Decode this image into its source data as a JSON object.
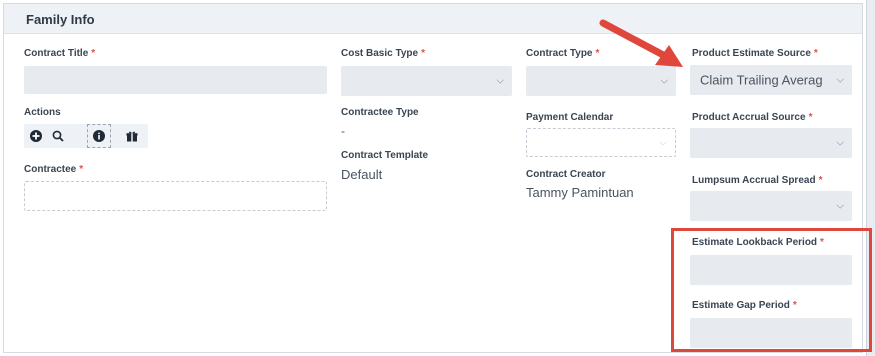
{
  "section": {
    "title": "Family Info"
  },
  "fields": {
    "contract_title": {
      "label": "Contract Title",
      "required": "*",
      "value": ""
    },
    "cost_basic_type": {
      "label": "Cost Basic Type",
      "required": "*"
    },
    "contract_type": {
      "label": "Contract Type",
      "required": "*"
    },
    "product_estimate_source": {
      "label": "Product Estimate Source",
      "required": "*",
      "value": "Claim Trailing Averag"
    },
    "actions": {
      "label": "Actions"
    },
    "contractee_type": {
      "label": "Contractee Type",
      "value": "-"
    },
    "payment_calendar": {
      "label": "Payment Calendar"
    },
    "product_accrual_source": {
      "label": "Product Accrual Source",
      "required": "*"
    },
    "contract_template": {
      "label": "Contract Template",
      "value": "Default"
    },
    "contractee": {
      "label": "Contractee",
      "required": "*"
    },
    "contract_creator": {
      "label": "Contract Creator",
      "value": "Tammy Pamintuan"
    },
    "lumpsum_accrual_spread": {
      "label": "Lumpsum Accrual Spread",
      "required": "*"
    },
    "estimate_lookback_period": {
      "label": "Estimate Lookback Period",
      "required": "*"
    },
    "estimate_gap_period": {
      "label": "Estimate Gap Period",
      "required": "*"
    }
  },
  "toolbar": {
    "icons": [
      "plus-circle-icon",
      "search-icon",
      "info-icon",
      "gift-icon"
    ],
    "glyphs": {
      "add": "⊕",
      "search": "⚲",
      "info": "ℹ",
      "gift": "🎁"
    }
  },
  "chevron": "⌵",
  "colors": {
    "required": "#d9534f",
    "highlight": "#e0473c",
    "field_bg": "#e7eaee",
    "header_bg": "#eef1f5"
  }
}
